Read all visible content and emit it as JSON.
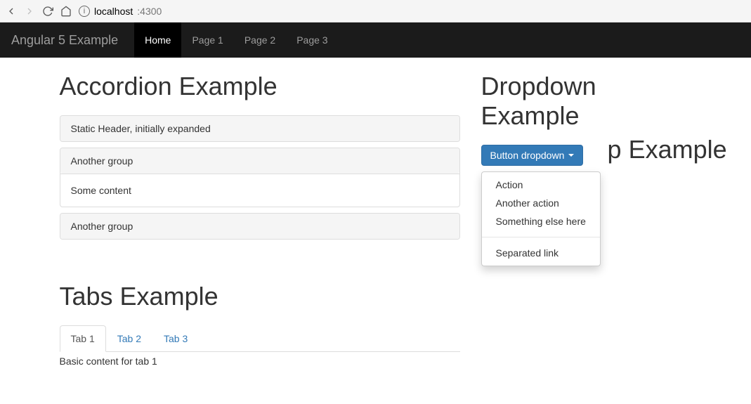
{
  "browser": {
    "url_host": "localhost",
    "url_port": ":4300"
  },
  "navbar": {
    "brand": "Angular 5 Example",
    "items": [
      {
        "label": "Home",
        "active": true
      },
      {
        "label": "Page 1",
        "active": false
      },
      {
        "label": "Page 2",
        "active": false
      },
      {
        "label": "Page 3",
        "active": false
      }
    ]
  },
  "accordion": {
    "title": "Accordion Example",
    "panels": [
      {
        "header": "Static Header, initially expanded",
        "body": null
      },
      {
        "header": "Another group",
        "body": "Some content"
      },
      {
        "header": "Another group",
        "body": null
      }
    ]
  },
  "dropdown": {
    "title": "Dropdown Example",
    "button_label": "Button dropdown",
    "items": [
      {
        "label": "Action"
      },
      {
        "label": "Another action"
      },
      {
        "label": "Something else here"
      }
    ],
    "separated": {
      "label": "Separated link"
    },
    "behind_title_visible": "p Example"
  },
  "tabs": {
    "title": "Tabs Example",
    "items": [
      {
        "label": "Tab 1",
        "active": true
      },
      {
        "label": "Tab 2",
        "active": false
      },
      {
        "label": "Tab 3",
        "active": false
      }
    ],
    "content": "Basic content for tab 1"
  }
}
